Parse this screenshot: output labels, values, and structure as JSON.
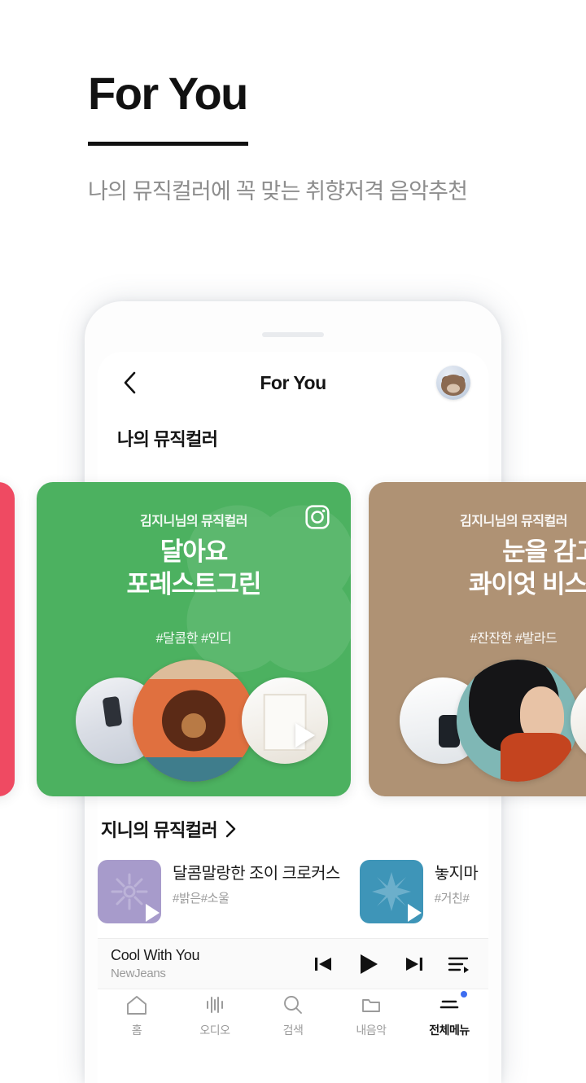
{
  "promo": {
    "title": "For You",
    "subtitle": "나의 뮤직컬러에 꼭 맞는\n취향저격 음악추천"
  },
  "app": {
    "appbar": {
      "back_icon": "chevron-left-icon",
      "title": "For You",
      "avatar_icon": "user-avatar-bear"
    },
    "section_my": {
      "title": "나의 뮤직컬러"
    }
  },
  "carousel": {
    "cards": [
      {
        "id": "pink",
        "color": "#ef4a62"
      },
      {
        "id": "green",
        "color": "#4cb160",
        "owner": "김지니님의 뮤직컬러",
        "name": "달아요\n포레스트그린",
        "tags": "#달콤한 #인디",
        "share_icon": "instagram-icon"
      },
      {
        "id": "brown",
        "color": "#af9274",
        "owner": "김지니님의 뮤직컬러",
        "name": "눈을 감고\n콰이엇 비스코티",
        "tags": "#잔잔한 #발라드"
      }
    ]
  },
  "genie": {
    "header": "지니의 뮤직컬러",
    "chevron_icon": "chevron-right-icon",
    "items": [
      {
        "title": "달콤말랑한 조이 크로커스",
        "tags": "#밝은#소울",
        "color": "#a79bcb"
      },
      {
        "title": "놓지마",
        "tags": "#거친#",
        "color": "#3e95b8"
      }
    ]
  },
  "player": {
    "track": "Cool With You",
    "artist": "NewJeans",
    "controls": [
      {
        "name": "prev-button",
        "icon": "skip-previous-icon"
      },
      {
        "name": "play-button",
        "icon": "play-icon"
      },
      {
        "name": "next-button",
        "icon": "skip-next-icon"
      },
      {
        "name": "playlist-button",
        "icon": "playlist-icon"
      }
    ]
  },
  "bottom_nav": {
    "items": [
      {
        "label": "홈",
        "icon": "home-icon",
        "active": false
      },
      {
        "label": "오디오",
        "icon": "audio-wave-icon",
        "active": false
      },
      {
        "label": "검색",
        "icon": "search-icon",
        "active": false
      },
      {
        "label": "내음악",
        "icon": "folder-icon",
        "active": false
      },
      {
        "label": "전체메뉴",
        "icon": "menu-icon",
        "active": true,
        "badge": true
      }
    ]
  },
  "colors": {
    "accent_green": "#4cb160",
    "accent_brown": "#af9274",
    "accent_pink": "#ef4a62",
    "badge_blue": "#3d6df0"
  }
}
